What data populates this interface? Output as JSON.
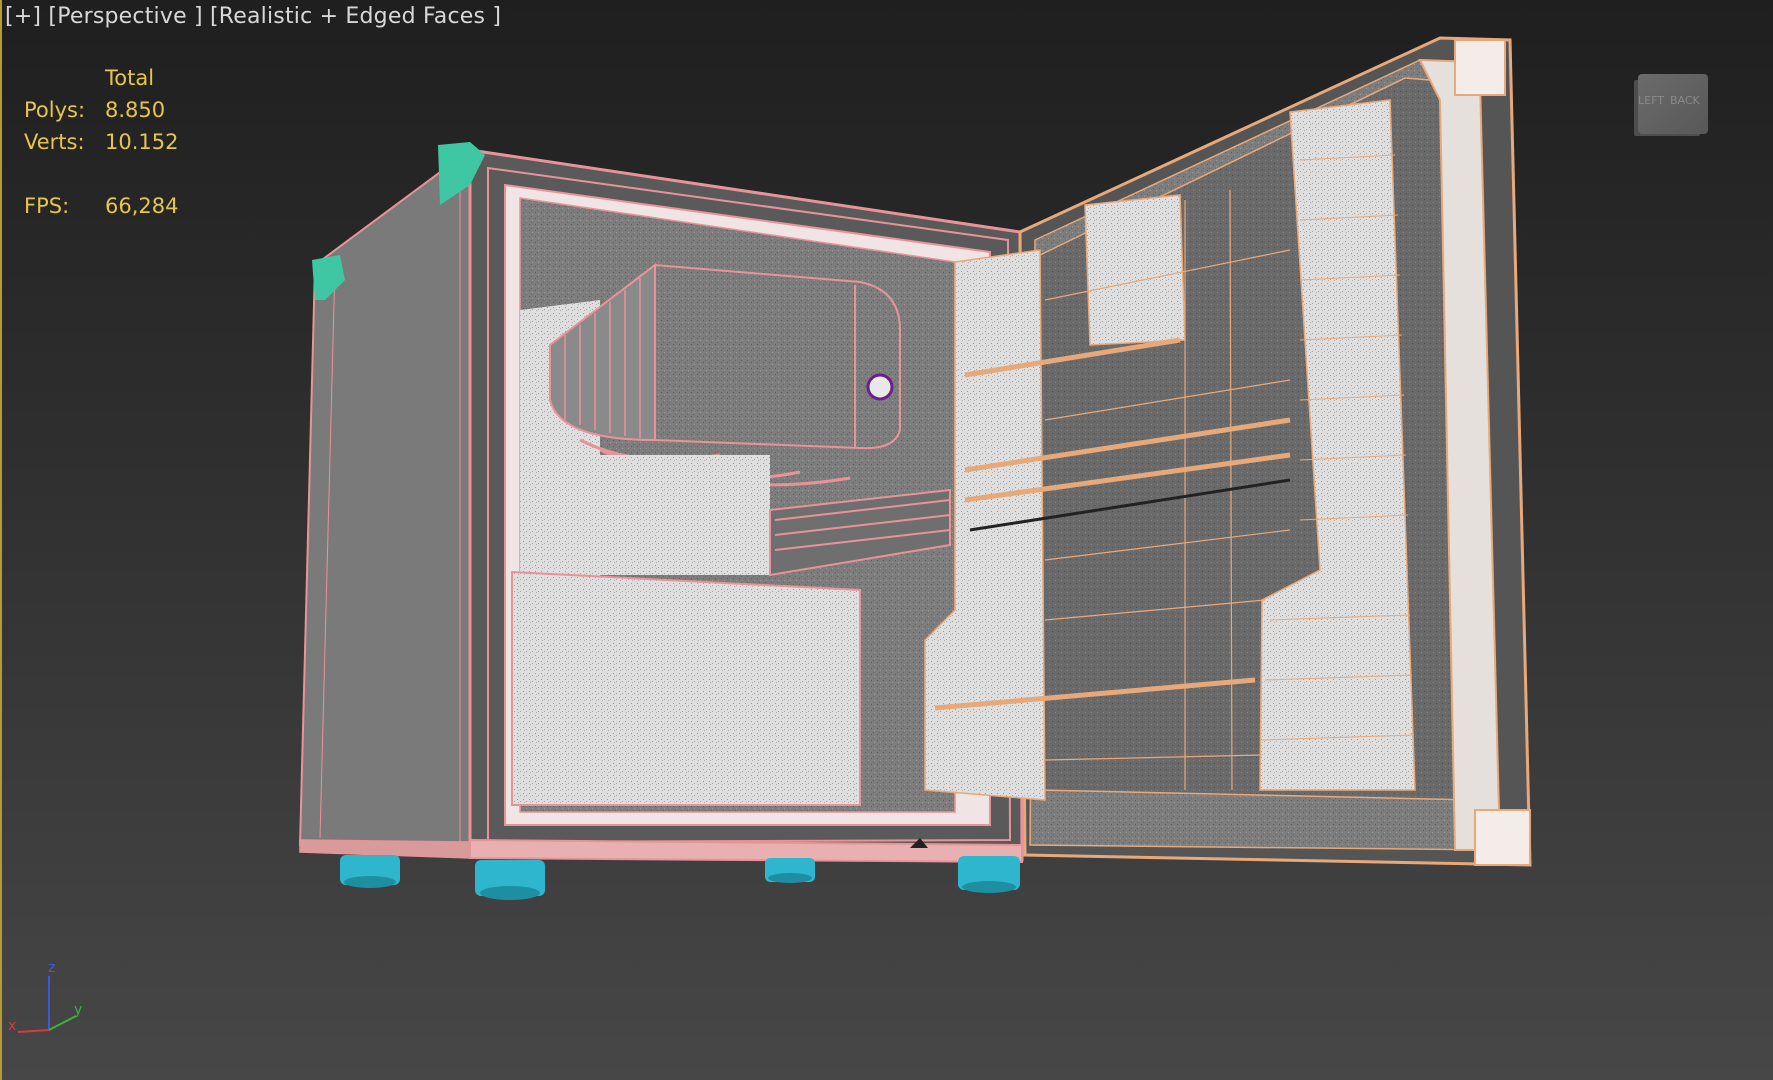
{
  "viewport": {
    "label_plus": "[+]",
    "label_view": "[Perspective ]",
    "label_shading": "[Realistic + Edged Faces ]"
  },
  "stats": {
    "header": "Total",
    "polys_label": "Polys:",
    "polys_value": "8.850",
    "verts_label": "Verts:",
    "verts_value": "10.152",
    "fps_label": "FPS:",
    "fps_value": "66,284"
  },
  "viewcube": {
    "left_face": "LEFT",
    "back_face": "BACK"
  },
  "axis_tripod": {
    "z": "z",
    "x": "x",
    "y": "y"
  },
  "colors": {
    "stats_text": "#e6c64a",
    "cabinet_edges": "#e8939a",
    "door_edges": "#e8a97a",
    "feet": "#2fb6cf",
    "hinges": "#3fc7a3",
    "viewport_border": "#b69a3a"
  }
}
